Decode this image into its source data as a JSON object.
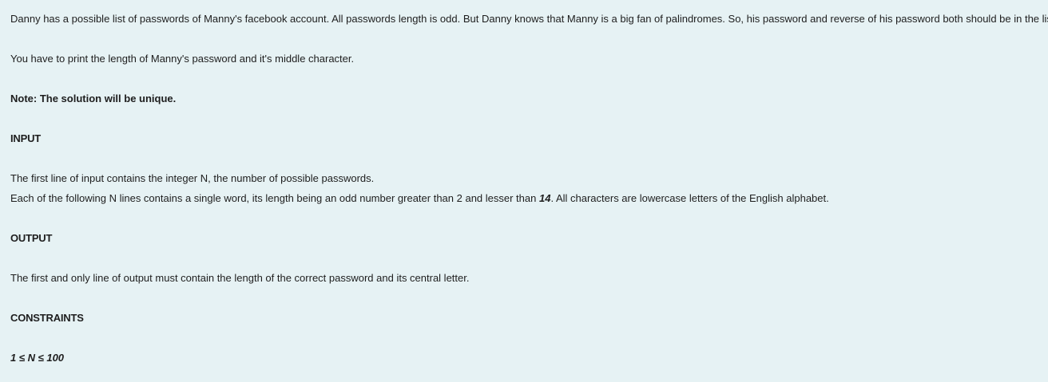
{
  "statement": {
    "intro": "Danny has a possible list of passwords of Manny's facebook account. All passwords length is odd. But Danny knows that Manny is a big fan of palindromes. So, his password and reverse of his password both should be in the list.",
    "task": "You have to print the length of Manny's password and it's middle character.",
    "note": "Note: The solution will be unique."
  },
  "input_section": {
    "heading": "INPUT",
    "line1": "The first line of input contains the integer N, the number of possible passwords.",
    "line2_before": "Each of the following N lines contains a single word, its length being an odd number greater than 2 and lesser than ",
    "line2_number": "14",
    "line2_after": ". All characters are lowercase letters of the English alphabet."
  },
  "output_section": {
    "heading": "OUTPUT",
    "line1": "The first and only line of output must contain the length of the correct password and its central letter."
  },
  "constraints_section": {
    "heading": "CONSTRAINTS",
    "value": "1 ≤ N ≤ 100"
  }
}
